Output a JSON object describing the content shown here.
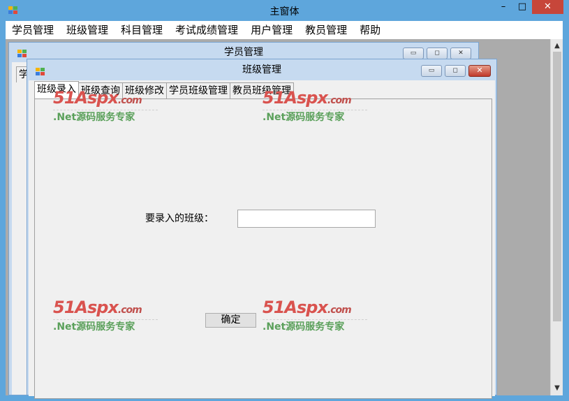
{
  "main": {
    "title": "主窗体",
    "controls": {
      "minimize": "–",
      "maximize": "□",
      "close": "✕"
    },
    "menu": [
      "学员管理",
      "班级管理",
      "科目管理",
      "考试成绩管理",
      "用户管理",
      "教员管理",
      "帮助"
    ]
  },
  "back_window": {
    "title": "学员管理",
    "tab_fragment": "学",
    "controls": {
      "minimize": "▭",
      "maximize": "◻",
      "close": "✕"
    }
  },
  "front_window": {
    "title": "班级管理",
    "controls": {
      "minimize": "▭",
      "maximize": "◻",
      "close": "✕"
    },
    "tabs": [
      "班级录入",
      "班级查询",
      "班级修改",
      "学员班级管理",
      "教员班级管理"
    ],
    "active_tab": "班级录入",
    "form": {
      "label": "要录入的班级：",
      "input_value": "",
      "submit": "确定"
    }
  },
  "watermark": {
    "logo_main": "51Aspx",
    "logo_suffix": ".com",
    "subtitle": ".Net源码服务专家"
  },
  "icons": [
    "app-icon",
    "chevron-up-icon",
    "chevron-down-icon"
  ]
}
